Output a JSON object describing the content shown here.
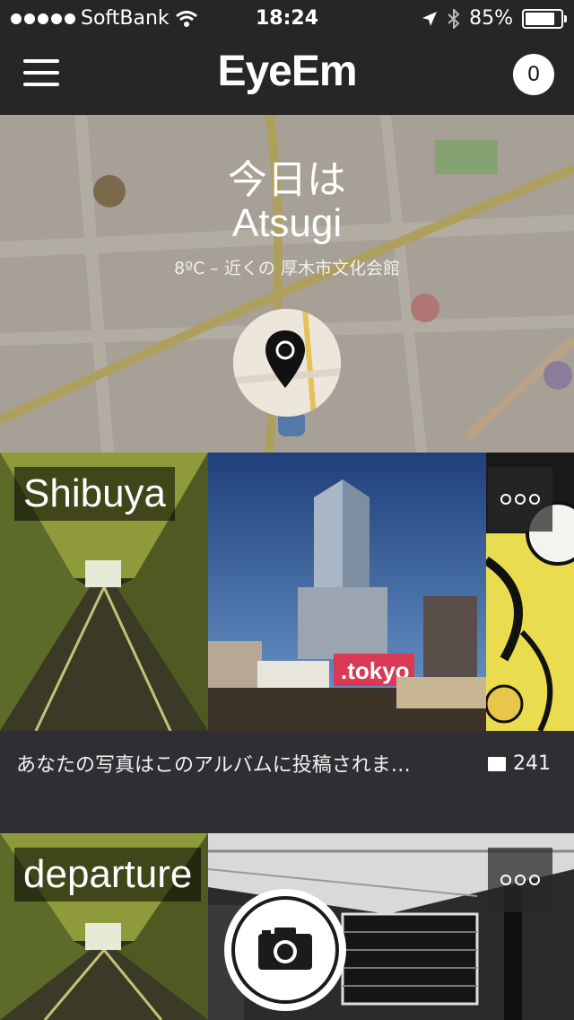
{
  "status_bar": {
    "carrier": "SoftBank",
    "time": "18:24",
    "battery": "85%",
    "battery_level": 0.85
  },
  "nav": {
    "logo": "EyeEm",
    "notification_count": "0"
  },
  "location": {
    "today_label": "今日は",
    "city": "Atsugi",
    "weather_line": "8ºC – 近くの 厚木市文化会館"
  },
  "albums": [
    {
      "title": "Shibuya",
      "description": "あなたの写真はこのアルバムに投稿されま…",
      "photo_count": "241"
    },
    {
      "title": "departure"
    }
  ],
  "icons": {
    "menu": "hamburger-icon",
    "wifi": "wifi-icon",
    "location_arrow": "location-arrow-icon",
    "bluetooth": "bluetooth-icon",
    "battery": "battery-icon",
    "map_pin": "map-pin-icon",
    "more": "more-dots-icon",
    "photos": "photo-stack-icon",
    "camera": "camera-icon"
  },
  "colors": {
    "bar_background": "#262626",
    "album_background": "#2f2f33"
  }
}
